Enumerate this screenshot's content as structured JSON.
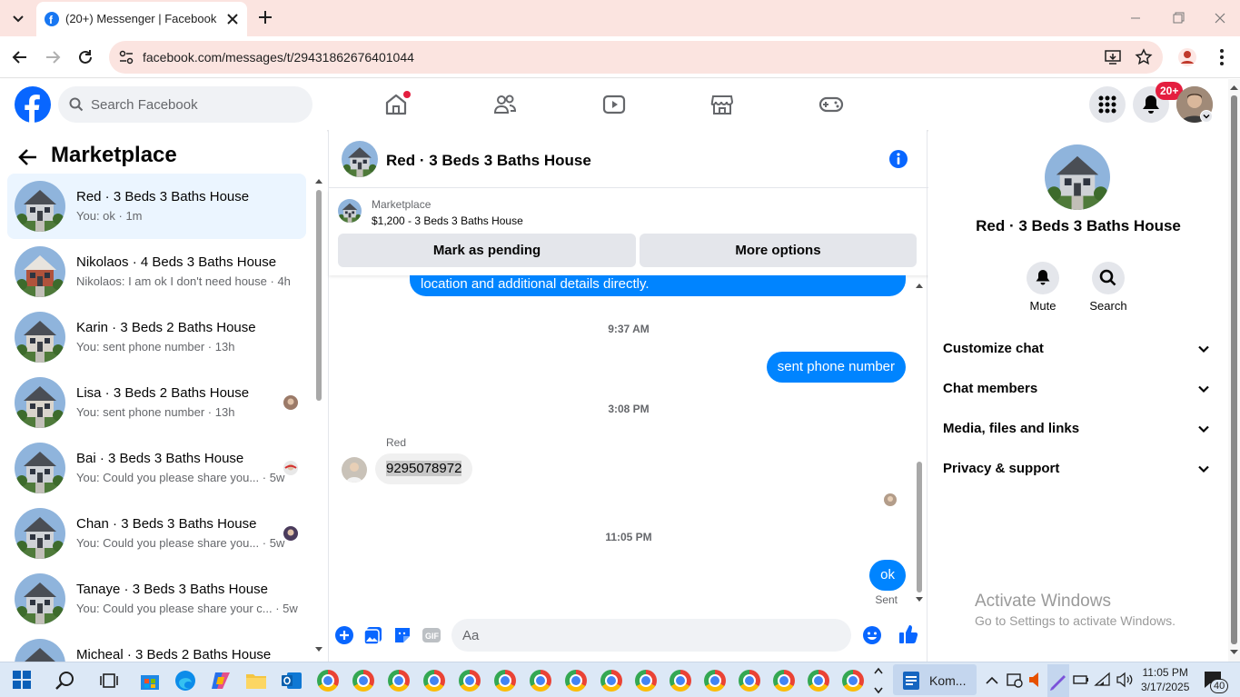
{
  "browser": {
    "tab_title": "(20+) Messenger | Facebook",
    "url": "facebook.com/messages/t/29431862676401044"
  },
  "facebook": {
    "search_placeholder": "Search Facebook",
    "notif_badge": "20+",
    "brand_color": "#0866ff"
  },
  "left": {
    "title": "Marketplace",
    "conversations": [
      {
        "name": "Red · 3 Beds 3 Baths House",
        "preview": "You: ok · 1m",
        "active": true
      },
      {
        "name": "Nikolaos · 4 Beds 3 Baths House",
        "preview": "Nikolaos: I am ok I don't need house · 4h"
      },
      {
        "name": "Karin · 3 Beds 2 Baths House",
        "preview": "You: sent phone number · 13h"
      },
      {
        "name": "Lisa · 3 Beds 2 Baths House",
        "preview": "You: sent phone number · 13h"
      },
      {
        "name": "Bai · 3 Beds 3 Baths House",
        "preview": "You: Could you please share you... · 5w"
      },
      {
        "name": "Chan · 3 Beds 3 Baths House",
        "preview": "You: Could you please share you... · 5w"
      },
      {
        "name": "Tanaye · 3 Beds 3 Baths House",
        "preview": "You: Could you please share your c... · 5w"
      },
      {
        "name": "Micheal · 3 Beds 2 Baths House",
        "preview": ""
      }
    ]
  },
  "chat": {
    "title": "Red · 3 Beds 3 Baths House",
    "listing_source": "Marketplace",
    "listing_desc": "$1,200 - 3 Beds 3 Baths House",
    "mark_pending_label": "Mark as pending",
    "more_options_label": "More options",
    "messages": {
      "outgoing_partial": "location and additional details directly.",
      "time1": "9:37 AM",
      "outgoing1": "sent phone number",
      "time2": "3:08 PM",
      "sender_name": "Red",
      "incoming1": "9295078972",
      "time3": "11:05 PM",
      "outgoing2": "ok",
      "status": "Sent"
    },
    "composer_placeholder": "Aa"
  },
  "right": {
    "name": "Red · 3 Beds 3 Baths House",
    "mute_label": "Mute",
    "search_label": "Search",
    "sections": [
      "Customize chat",
      "Chat members",
      "Media, files and links",
      "Privacy & support"
    ]
  },
  "watermark": {
    "line1": "Activate Windows",
    "line2": "Go to Settings to activate Windows."
  },
  "taskbar": {
    "app_label": "Kom...",
    "time": "11:05 PM",
    "date": "3/17/2025",
    "notif_count": "40"
  }
}
